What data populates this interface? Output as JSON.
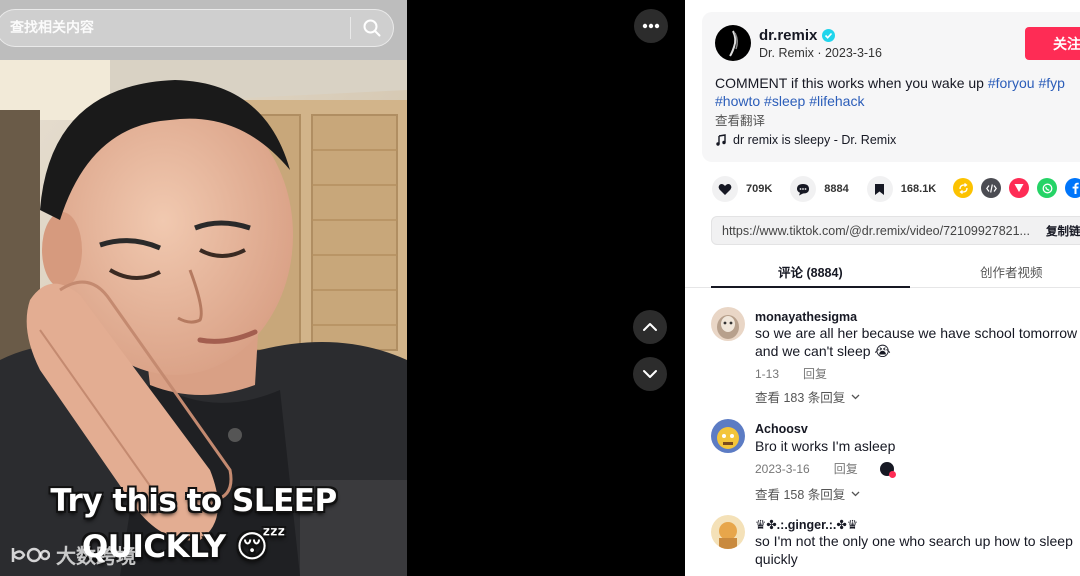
{
  "search": {
    "placeholder": "查找相关内容"
  },
  "video": {
    "caption_line1": "Try this to SLEEP",
    "caption_line2": "QUICKLY 😴",
    "watermark": "大数跨境"
  },
  "post": {
    "author_name": "dr.remix",
    "author_meta": "Dr. Remix · 2023-3-16",
    "follow_label": "关注",
    "description_text": "COMMENT if this works when you wake up ",
    "hashtags": [
      "#foryou",
      "#fyp",
      "#howto",
      "#sleep",
      "#lifehack"
    ],
    "translate_label": "查看翻译",
    "music": "dr remix is sleepy - Dr. Remix"
  },
  "actions": {
    "likes": "709K",
    "comments": "8884",
    "saves": "168.1K"
  },
  "share": {
    "link": "https://www.tiktok.com/@dr.remix/video/72109927821...",
    "copy_label": "复制链接"
  },
  "tabs": {
    "comments": "评论 (8884)",
    "creator_videos": "创作者视频"
  },
  "comments": [
    {
      "user": "monayathesigma",
      "text": "so we are all her because we have school tomorrow and we can't sleep 😭",
      "date": "1-13",
      "reply_label": "回复",
      "view_replies": "查看 183 条回复"
    },
    {
      "user": "Achoosv",
      "text": "Bro it works I'm asleep",
      "date": "2023-3-16",
      "reply_label": "回复",
      "view_replies": "查看 158 条回复"
    },
    {
      "user": "♛✤.:.ginger.:.✤♛",
      "text": "so I'm not the only one who search up how to sleep quickly"
    }
  ],
  "colors": {
    "accent": "#fe2c55",
    "hashtag": "#2b5db9",
    "verified": "#20d5ec"
  }
}
